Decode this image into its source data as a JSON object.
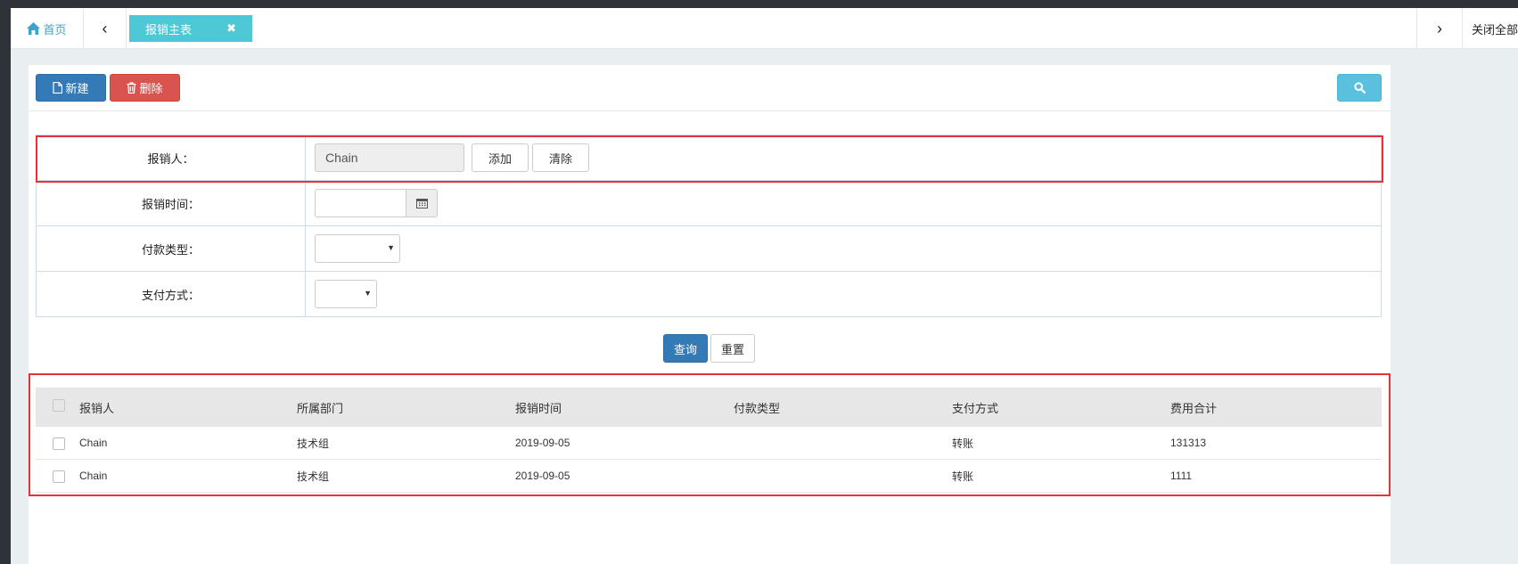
{
  "tabs": {
    "home_label": "首页",
    "active_tab": "报销主表",
    "close_symbol": "✖",
    "prev_symbol": "‹",
    "next_symbol": "›",
    "close_all_label": "关闭全部"
  },
  "toolbar": {
    "new_label": "新建",
    "delete_label": "删除"
  },
  "form": {
    "person_label": "报销人：",
    "person_value": "Chain",
    "add_label": "添加",
    "clear_label": "清除",
    "date_label": "报销时间：",
    "date_value": "",
    "payment_type_label": "付款类型：",
    "payment_type_value": "",
    "payment_method_label": "支付方式：",
    "payment_method_value": "",
    "query_label": "查询",
    "reset_label": "重置"
  },
  "table": {
    "headers": [
      "报销人",
      "所属部门",
      "报销时间",
      "付款类型",
      "支付方式",
      "费用合计"
    ],
    "rows": [
      [
        "Chain",
        "技术组",
        "2019-09-05",
        "",
        "转账",
        "131313"
      ],
      [
        "Chain",
        "技术组",
        "2019-09-05",
        "",
        "转账",
        "1111"
      ]
    ]
  },
  "colors": {
    "primary": "#337ab7",
    "danger": "#d9534f",
    "info": "#5bc0de",
    "tab_active": "#4fc8d6",
    "highlight": "#e8313a"
  },
  "icons": {
    "home": "home-icon",
    "new": "file-icon",
    "delete": "trash-icon",
    "search": "search-icon",
    "calendar": "calendar-icon"
  }
}
